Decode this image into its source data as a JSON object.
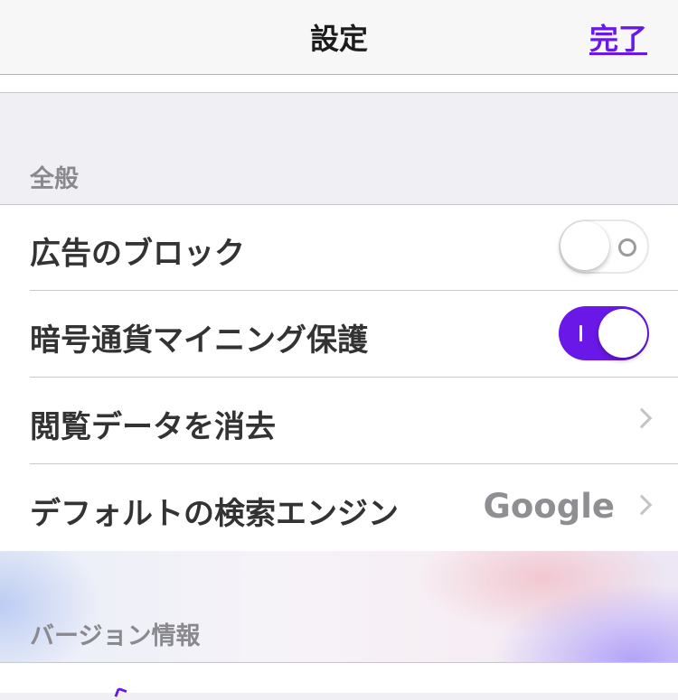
{
  "navbar": {
    "title": "設定",
    "done_label": "完了"
  },
  "sections": {
    "general_header": "全般",
    "version_header": "バージョン情報"
  },
  "rows": [
    {
      "label": "広告のブロック",
      "control": "toggle",
      "state": "off"
    },
    {
      "label": "暗号通貨マイニング保護",
      "control": "toggle",
      "state": "on"
    },
    {
      "label": "閲覧データを消去",
      "control": "disclosure"
    },
    {
      "label": "デフォルトの検索エンジン",
      "control": "disclosure",
      "value": "Google"
    }
  ],
  "colors": {
    "accent": "#6a18e8",
    "secondary_text": "#8e8e93",
    "background": "#efeff4"
  },
  "icons": {
    "chevron": "chevron-right-icon"
  }
}
